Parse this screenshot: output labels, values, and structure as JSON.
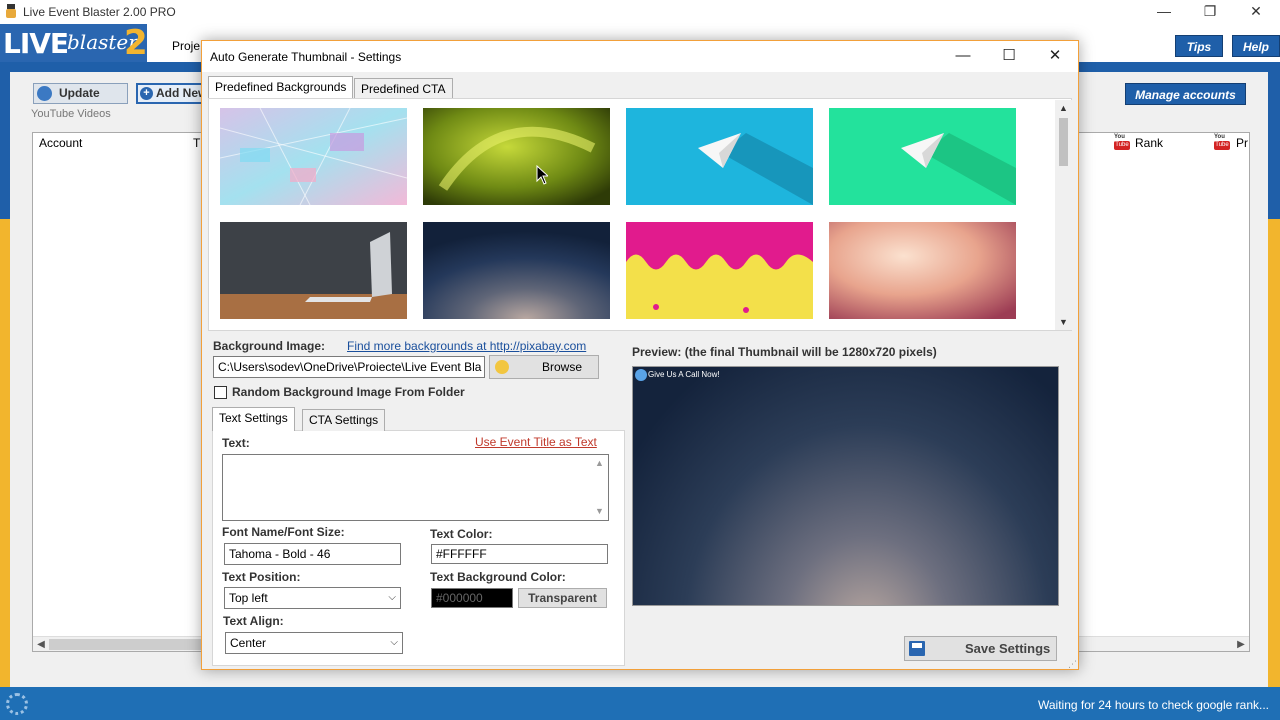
{
  "app": {
    "title": "Live Event Blaster 2.00 PRO",
    "logo": {
      "live": "LIVE",
      "blaster": "blaster",
      "two": "2"
    },
    "menu_project": "Proje",
    "buttons": {
      "tips": "Tips",
      "help": "Help",
      "manage_accounts": "Manage accounts",
      "update": "Update",
      "add_new": "Add New"
    },
    "group_label": "YouTube Videos",
    "columns": {
      "account": "Account",
      "t_partial": "T",
      "rank": "Rank",
      "pr_partial": "Pr"
    },
    "youtube_icon_text": {
      "top": "You",
      "bottom": "Tube"
    },
    "status_text": "Waiting for 24 hours to check google rank..."
  },
  "dialog": {
    "title": "Auto Generate Thumbnail - Settings",
    "tabs": {
      "predefined_backgrounds": "Predefined Backgrounds",
      "predefined_cta": "Predefined CTA"
    },
    "background_image_label": "Background Image:",
    "find_more_link": "Find more backgrounds at http://pixabay.com",
    "background_path": "C:\\Users\\sodev\\OneDrive\\Proiecte\\Live Event Bla",
    "browse_label": "Browse",
    "random_bg_label": "Random Background Image From Folder",
    "preview_label": "Preview: (the final Thumbnail will be 1280x720 pixels)",
    "preview_cta": "Give Us A Call Now!",
    "sub_tabs": {
      "text_settings": "Text Settings",
      "cta_settings": "CTA Settings"
    },
    "text_label": "Text:",
    "use_event_title_link": "Use Event Title as Text",
    "font_label": "Font Name/Font Size:",
    "font_value": "Tahoma - Bold - 46",
    "text_color_label": "Text Color:",
    "text_color_value": "#FFFFFF",
    "text_position_label": "Text Position:",
    "text_position_value": "Top left",
    "text_bg_color_label": "Text Background Color:",
    "text_bg_color_value": "#000000",
    "transparent_label": "Transparent",
    "text_align_label": "Text Align:",
    "text_align_value": "Center",
    "save_label": "Save Settings"
  },
  "colors": {
    "brand_blue": "#1f5fa9",
    "brand_orange": "#f2b52d",
    "link_red": "#c0392b"
  }
}
